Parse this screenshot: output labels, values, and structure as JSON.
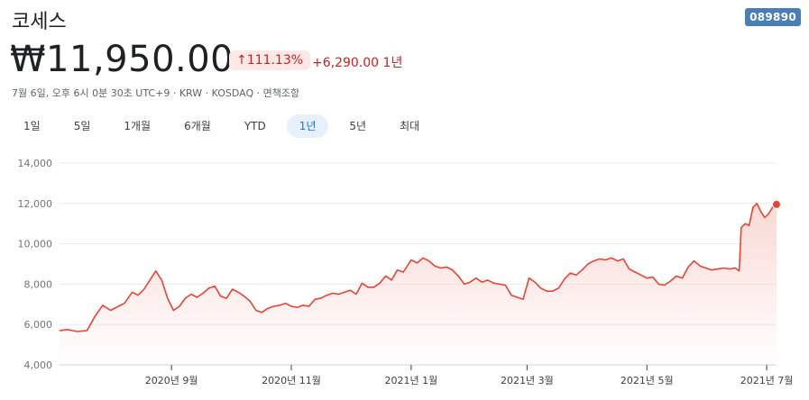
{
  "header": {
    "title": "코세스",
    "ticker": "089890"
  },
  "quote": {
    "price": "₩11,950.00",
    "change_pct": "111.13%",
    "change_abs": "+6,290.00",
    "period": "1년",
    "meta": "7월 6일, 오후 6시 0분 30초 UTC+9 · KRW · KOSDAQ · 면책조항"
  },
  "tabs": [
    "1일",
    "5일",
    "1개월",
    "6개월",
    "YTD",
    "1년",
    "5년",
    "최대"
  ],
  "active_tab": "1년",
  "colors": {
    "line": "#ea4335",
    "fill": "#f9d5d1",
    "grid": "#e8eaed",
    "accent": "#c5221f",
    "tab_active": "#1a73e8"
  },
  "icons": {
    "change_arrow": "arrow-up-icon"
  },
  "chart_data": {
    "type": "area",
    "ylim": [
      4000,
      14000
    ],
    "yticks": [
      4000,
      6000,
      8000,
      10000,
      12000,
      14000
    ],
    "ytick_labels": [
      "4,000",
      "6,000",
      "8,000",
      "10,000",
      "12,000",
      "14,000"
    ],
    "xticks": [
      {
        "date": "2020-09-01",
        "label": "2020년 9월"
      },
      {
        "date": "2020-11-01",
        "label": "2020년 11월"
      },
      {
        "date": "2021-01-01",
        "label": "2021년 1월"
      },
      {
        "date": "2021-03-01",
        "label": "2021년 3월"
      },
      {
        "date": "2021-05-01",
        "label": "2021년 5월"
      },
      {
        "date": "2021-07-01",
        "label": "2021년 7월"
      }
    ],
    "series": [
      {
        "points": [
          [
            "2020-07-06",
            5700
          ],
          [
            "2020-07-10",
            5750
          ],
          [
            "2020-07-15",
            5650
          ],
          [
            "2020-07-20",
            5700
          ],
          [
            "2020-07-24",
            6400
          ],
          [
            "2020-07-28",
            6950
          ],
          [
            "2020-08-01",
            6700
          ],
          [
            "2020-08-05",
            6900
          ],
          [
            "2020-08-08",
            7050
          ],
          [
            "2020-08-12",
            7600
          ],
          [
            "2020-08-15",
            7450
          ],
          [
            "2020-08-18",
            7750
          ],
          [
            "2020-08-21",
            8200
          ],
          [
            "2020-08-24",
            8650
          ],
          [
            "2020-08-27",
            8200
          ],
          [
            "2020-08-30",
            7300
          ],
          [
            "2020-09-02",
            6700
          ],
          [
            "2020-09-05",
            6900
          ],
          [
            "2020-09-08",
            7300
          ],
          [
            "2020-09-11",
            7500
          ],
          [
            "2020-09-14",
            7350
          ],
          [
            "2020-09-17",
            7550
          ],
          [
            "2020-09-20",
            7800
          ],
          [
            "2020-09-23",
            7900
          ],
          [
            "2020-09-26",
            7400
          ],
          [
            "2020-09-29",
            7300
          ],
          [
            "2020-10-02",
            7750
          ],
          [
            "2020-10-05",
            7600
          ],
          [
            "2020-10-08",
            7400
          ],
          [
            "2020-10-11",
            7150
          ],
          [
            "2020-10-14",
            6700
          ],
          [
            "2020-10-17",
            6600
          ],
          [
            "2020-10-20",
            6800
          ],
          [
            "2020-10-23",
            6900
          ],
          [
            "2020-10-26",
            6950
          ],
          [
            "2020-10-29",
            7050
          ],
          [
            "2020-11-01",
            6900
          ],
          [
            "2020-11-04",
            6850
          ],
          [
            "2020-11-07",
            6950
          ],
          [
            "2020-11-10",
            6900
          ],
          [
            "2020-11-13",
            7250
          ],
          [
            "2020-11-16",
            7300
          ],
          [
            "2020-11-19",
            7450
          ],
          [
            "2020-11-22",
            7550
          ],
          [
            "2020-11-25",
            7500
          ],
          [
            "2020-11-28",
            7600
          ],
          [
            "2020-12-01",
            7700
          ],
          [
            "2020-12-04",
            7500
          ],
          [
            "2020-12-07",
            8050
          ],
          [
            "2020-12-10",
            7850
          ],
          [
            "2020-12-13",
            7850
          ],
          [
            "2020-12-16",
            8050
          ],
          [
            "2020-12-19",
            8400
          ],
          [
            "2020-12-22",
            8200
          ],
          [
            "2020-12-25",
            8700
          ],
          [
            "2020-12-28",
            8600
          ],
          [
            "2021-01-01",
            9200
          ],
          [
            "2021-01-04",
            9050
          ],
          [
            "2021-01-07",
            9300
          ],
          [
            "2021-01-10",
            9150
          ],
          [
            "2021-01-13",
            8900
          ],
          [
            "2021-01-16",
            8800
          ],
          [
            "2021-01-19",
            8850
          ],
          [
            "2021-01-22",
            8700
          ],
          [
            "2021-01-25",
            8400
          ],
          [
            "2021-01-28",
            8000
          ],
          [
            "2021-01-31",
            8100
          ],
          [
            "2021-02-03",
            8300
          ],
          [
            "2021-02-06",
            8100
          ],
          [
            "2021-02-09",
            8200
          ],
          [
            "2021-02-12",
            8050
          ],
          [
            "2021-02-15",
            8000
          ],
          [
            "2021-02-18",
            7950
          ],
          [
            "2021-02-21",
            7450
          ],
          [
            "2021-02-24",
            7350
          ],
          [
            "2021-02-27",
            7250
          ],
          [
            "2021-03-02",
            8300
          ],
          [
            "2021-03-05",
            8100
          ],
          [
            "2021-03-08",
            7800
          ],
          [
            "2021-03-11",
            7650
          ],
          [
            "2021-03-14",
            7650
          ],
          [
            "2021-03-17",
            7800
          ],
          [
            "2021-03-20",
            8250
          ],
          [
            "2021-03-23",
            8550
          ],
          [
            "2021-03-26",
            8450
          ],
          [
            "2021-03-29",
            8700
          ],
          [
            "2021-04-01",
            9000
          ],
          [
            "2021-04-04",
            9150
          ],
          [
            "2021-04-07",
            9250
          ],
          [
            "2021-04-10",
            9200
          ],
          [
            "2021-04-13",
            9300
          ],
          [
            "2021-04-16",
            9150
          ],
          [
            "2021-04-19",
            9250
          ],
          [
            "2021-04-22",
            8750
          ],
          [
            "2021-04-25",
            8600
          ],
          [
            "2021-04-28",
            8450
          ],
          [
            "2021-05-01",
            8300
          ],
          [
            "2021-05-04",
            8350
          ],
          [
            "2021-05-07",
            8000
          ],
          [
            "2021-05-10",
            7950
          ],
          [
            "2021-05-13",
            8150
          ],
          [
            "2021-05-16",
            8400
          ],
          [
            "2021-05-19",
            8300
          ],
          [
            "2021-05-22",
            8850
          ],
          [
            "2021-05-25",
            9150
          ],
          [
            "2021-05-28",
            8900
          ],
          [
            "2021-05-31",
            8800
          ],
          [
            "2021-06-03",
            8700
          ],
          [
            "2021-06-06",
            8750
          ],
          [
            "2021-06-09",
            8800
          ],
          [
            "2021-06-12",
            8750
          ],
          [
            "2021-06-15",
            8800
          ],
          [
            "2021-06-17",
            8650
          ],
          [
            "2021-06-18",
            10800
          ],
          [
            "2021-06-20",
            11000
          ],
          [
            "2021-06-22",
            10900
          ],
          [
            "2021-06-24",
            11800
          ],
          [
            "2021-06-26",
            12000
          ],
          [
            "2021-06-28",
            11600
          ],
          [
            "2021-06-30",
            11300
          ],
          [
            "2021-07-02",
            11500
          ],
          [
            "2021-07-04",
            11800
          ],
          [
            "2021-07-06",
            11950
          ]
        ]
      }
    ]
  }
}
